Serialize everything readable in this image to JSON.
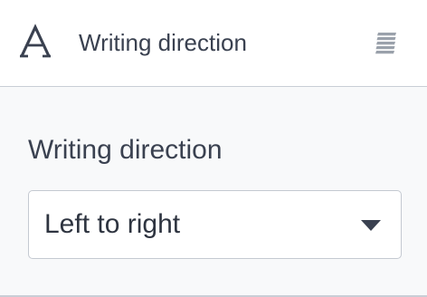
{
  "header": {
    "title": "Writing direction",
    "icon": "typography-a-icon",
    "handle_icon": "drag-handle-icon"
  },
  "field": {
    "label": "Writing direction",
    "select": {
      "value": "Left to right",
      "icon": "caret-down-icon"
    }
  },
  "colors": {
    "text": "#3a4150",
    "header_bg": "#ffffff",
    "body_bg": "#f8f9fa",
    "border": "#c9ced6",
    "icon": "#5c6370",
    "handle": "#9aa1ab"
  }
}
